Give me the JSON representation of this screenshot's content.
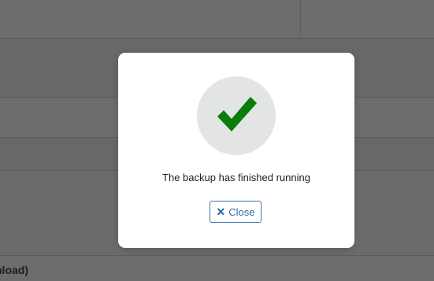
{
  "background": {
    "footer_fragment": "nload)"
  },
  "modal": {
    "icon": "checkmark-icon",
    "icon_color": "#0a7d0a",
    "message": "The backup has finished running",
    "close_button": {
      "icon": "close-icon",
      "icon_glyph": "✕",
      "label": "Close"
    }
  },
  "colors": {
    "overlay": "#6b6b6b",
    "button_accent": "#2c6aa8"
  }
}
